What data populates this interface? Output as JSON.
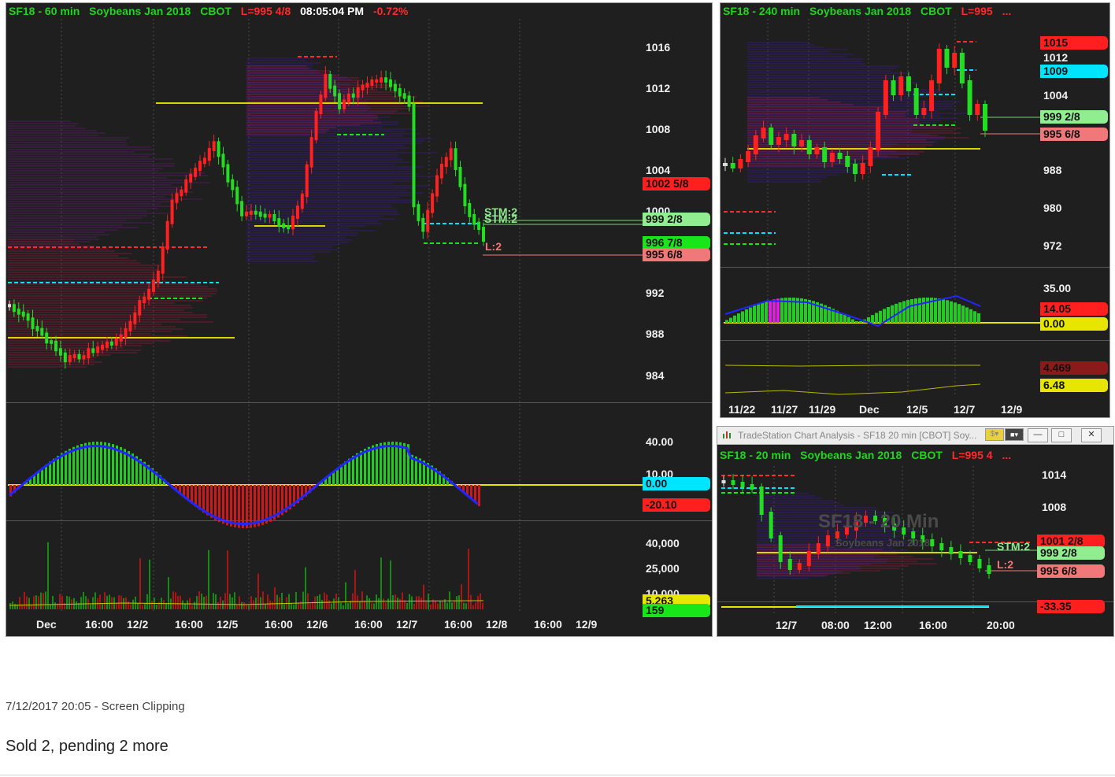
{
  "panel60": {
    "header": {
      "symbol": "SF18 - 60 min",
      "name": "Soybeans Jan 2018",
      "exch": "CBOT",
      "last": "L=995 4/8",
      "time": "08:05:04 PM",
      "chg": "-0.72%"
    },
    "y_axis": [
      "1016",
      "1012",
      "1008",
      "1004",
      "1000",
      "992",
      "988",
      "984"
    ],
    "price_labels": [
      {
        "text": "1002 5/8",
        "color": "#ff1f1f"
      },
      {
        "text": "999 2/8",
        "color": "#90ee90"
      },
      {
        "text": "996 7/8",
        "color": "#19e619"
      },
      {
        "text": "995 6/8",
        "color": "#f07878"
      }
    ],
    "annotations": {
      "stm1": "STM:2",
      "stm2": "STM:2",
      "limit": "L:2"
    },
    "osc_axis": [
      "40.00",
      "10.00"
    ],
    "osc_labels": [
      {
        "text": "0.00",
        "color": "#00e5ff"
      },
      {
        "text": "-20.10",
        "color": "#ff1f1f"
      }
    ],
    "vol_axis": [
      "40,000",
      "25,000",
      "10,000"
    ],
    "vol_labels": [
      {
        "text": "5,263",
        "color": "#e6e600"
      },
      {
        "text": "159",
        "color": "#19e619"
      }
    ],
    "x_axis": [
      "Dec",
      "16:00",
      "12/2",
      "16:00",
      "12/5",
      "16:00",
      "12/6",
      "16:00",
      "12/7",
      "16:00",
      "12/8",
      "16:00",
      "12/9"
    ]
  },
  "panel240": {
    "header": {
      "symbol": "SF18 - 240 min",
      "name": "Soybeans Jan 2018",
      "exch": "CBOT",
      "last": "L=995",
      "more": "..."
    },
    "y_axis": [
      "1012",
      "1004",
      "988",
      "980",
      "972"
    ],
    "price_labels": [
      {
        "text": "1015",
        "color": "#ff1f1f"
      },
      {
        "text": "1009",
        "color": "#00e5ff"
      },
      {
        "text": "999 2/8",
        "color": "#90ee90"
      },
      {
        "text": "995 6/8",
        "color": "#f07878"
      }
    ],
    "osc_axis": [
      "35.00"
    ],
    "osc_labels": [
      {
        "text": "14.05",
        "color": "#ff1f1f"
      },
      {
        "text": "0.00",
        "color": "#e6e600"
      }
    ],
    "ind_labels": [
      {
        "text": "4.469",
        "color": "#8b1a1a"
      },
      {
        "text": "6.48",
        "color": "#e6e600"
      }
    ],
    "x_axis": [
      "11/22",
      "11/27",
      "11/29",
      "Dec",
      "12/5",
      "12/7",
      "12/9"
    ]
  },
  "panel20": {
    "window_title": "TradeStation Chart Analysis - SF18 20 min [CBOT] Soy...",
    "header": {
      "symbol": "SF18 - 20 min",
      "name": "Soybeans Jan 2018",
      "exch": "CBOT",
      "last": "L=995 4",
      "more": "..."
    },
    "watermark": "SF18 - 20 Min",
    "watermark_sub": "Soybeans Jan 2018",
    "y_axis": [
      "1014",
      "1008"
    ],
    "price_labels": [
      {
        "text": "1001 2/8",
        "color": "#ff1f1f"
      },
      {
        "text": "999 2/8",
        "color": "#90ee90"
      },
      {
        "text": "995 6/8",
        "color": "#f07878"
      }
    ],
    "annotations": {
      "stm": "STM:2",
      "limit": "L:2"
    },
    "osc_labels": [
      {
        "text": "-33.35",
        "color": "#ff1f1f"
      }
    ],
    "x_axis": [
      "12/7",
      "08:00",
      "12:00",
      "16:00",
      "20:00"
    ]
  },
  "clipping_caption": "7/12/2017 20:05 - Screen Clipping",
  "note_text": "Sold 2, pending 2 more"
}
